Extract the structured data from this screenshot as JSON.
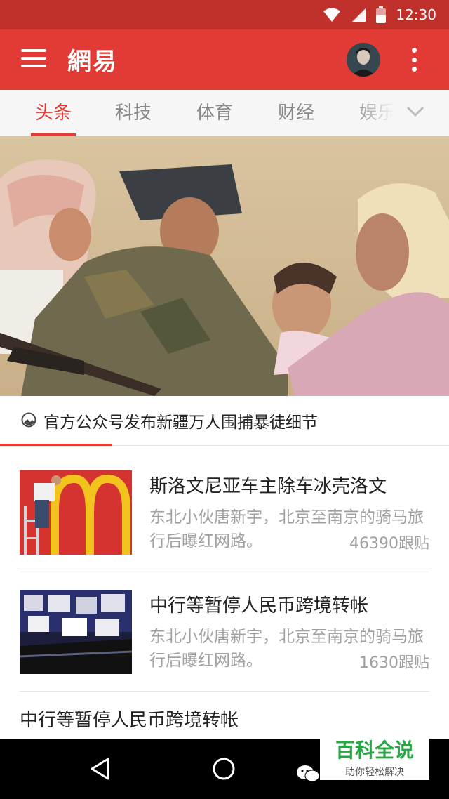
{
  "status_bar": {
    "time": "12:30"
  },
  "app_bar": {
    "title": "網易"
  },
  "tabs": [
    {
      "label": "头条",
      "active": true
    },
    {
      "label": "科技",
      "active": false
    },
    {
      "label": "体育",
      "active": false
    },
    {
      "label": "财经",
      "active": false
    },
    {
      "label": "娱乐",
      "active": false
    }
  ],
  "hero": {
    "caption": "官方公众号发布新疆万人围捕暴徒细节"
  },
  "news": [
    {
      "title": "斯洛文尼亚车主除车冰壳洛文",
      "summary": "东北小伙唐新宇，北京至南京的骑马旅行后曝红网路。",
      "count": "46390跟贴"
    },
    {
      "title": "中行等暂停人民币跨境转帐",
      "summary": "东北小伙唐新宇，北京至南京的骑马旅行后曝红网路。",
      "count": "1630跟贴"
    }
  ],
  "plain_news": {
    "title": "中行等暂停人民币跨境转帐"
  },
  "watermark": {
    "title": "百科全说",
    "subtitle": "助你轻松解决"
  },
  "colors": {
    "primary": "#e23b36",
    "status": "#c0302b"
  }
}
